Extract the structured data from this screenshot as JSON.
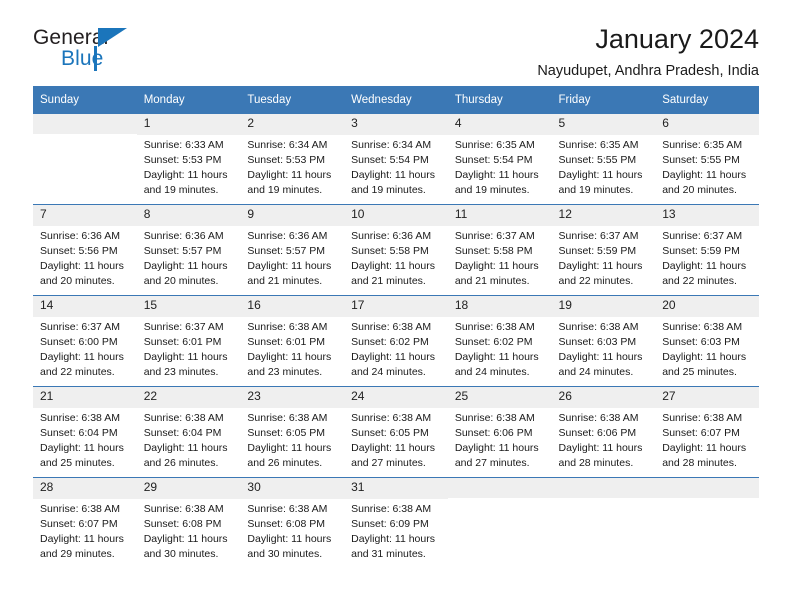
{
  "brand": {
    "name_part1": "General",
    "name_part2": "Blue",
    "accent_color": "#1b75bb"
  },
  "header": {
    "title": "January 2024",
    "subtitle": "Nayudupet, Andhra Pradesh, India"
  },
  "calendar": {
    "header_color": "#3b78b5",
    "daynum_band_color": "#efefef",
    "weekday_labels": [
      "Sunday",
      "Monday",
      "Tuesday",
      "Wednesday",
      "Thursday",
      "Friday",
      "Saturday"
    ],
    "weeks": [
      [
        {
          "date": "",
          "blank": true,
          "sunrise": "",
          "sunset": "",
          "daylight_line1": "",
          "daylight_line2": ""
        },
        {
          "date": "1",
          "sunrise": "Sunrise: 6:33 AM",
          "sunset": "Sunset: 5:53 PM",
          "daylight_line1": "Daylight: 11 hours",
          "daylight_line2": "and 19 minutes."
        },
        {
          "date": "2",
          "sunrise": "Sunrise: 6:34 AM",
          "sunset": "Sunset: 5:53 PM",
          "daylight_line1": "Daylight: 11 hours",
          "daylight_line2": "and 19 minutes."
        },
        {
          "date": "3",
          "sunrise": "Sunrise: 6:34 AM",
          "sunset": "Sunset: 5:54 PM",
          "daylight_line1": "Daylight: 11 hours",
          "daylight_line2": "and 19 minutes."
        },
        {
          "date": "4",
          "sunrise": "Sunrise: 6:35 AM",
          "sunset": "Sunset: 5:54 PM",
          "daylight_line1": "Daylight: 11 hours",
          "daylight_line2": "and 19 minutes."
        },
        {
          "date": "5",
          "sunrise": "Sunrise: 6:35 AM",
          "sunset": "Sunset: 5:55 PM",
          "daylight_line1": "Daylight: 11 hours",
          "daylight_line2": "and 19 minutes."
        },
        {
          "date": "6",
          "sunrise": "Sunrise: 6:35 AM",
          "sunset": "Sunset: 5:55 PM",
          "daylight_line1": "Daylight: 11 hours",
          "daylight_line2": "and 20 minutes."
        }
      ],
      [
        {
          "date": "7",
          "sunrise": "Sunrise: 6:36 AM",
          "sunset": "Sunset: 5:56 PM",
          "daylight_line1": "Daylight: 11 hours",
          "daylight_line2": "and 20 minutes."
        },
        {
          "date": "8",
          "sunrise": "Sunrise: 6:36 AM",
          "sunset": "Sunset: 5:57 PM",
          "daylight_line1": "Daylight: 11 hours",
          "daylight_line2": "and 20 minutes."
        },
        {
          "date": "9",
          "sunrise": "Sunrise: 6:36 AM",
          "sunset": "Sunset: 5:57 PM",
          "daylight_line1": "Daylight: 11 hours",
          "daylight_line2": "and 21 minutes."
        },
        {
          "date": "10",
          "sunrise": "Sunrise: 6:36 AM",
          "sunset": "Sunset: 5:58 PM",
          "daylight_line1": "Daylight: 11 hours",
          "daylight_line2": "and 21 minutes."
        },
        {
          "date": "11",
          "sunrise": "Sunrise: 6:37 AM",
          "sunset": "Sunset: 5:58 PM",
          "daylight_line1": "Daylight: 11 hours",
          "daylight_line2": "and 21 minutes."
        },
        {
          "date": "12",
          "sunrise": "Sunrise: 6:37 AM",
          "sunset": "Sunset: 5:59 PM",
          "daylight_line1": "Daylight: 11 hours",
          "daylight_line2": "and 22 minutes."
        },
        {
          "date": "13",
          "sunrise": "Sunrise: 6:37 AM",
          "sunset": "Sunset: 5:59 PM",
          "daylight_line1": "Daylight: 11 hours",
          "daylight_line2": "and 22 minutes."
        }
      ],
      [
        {
          "date": "14",
          "sunrise": "Sunrise: 6:37 AM",
          "sunset": "Sunset: 6:00 PM",
          "daylight_line1": "Daylight: 11 hours",
          "daylight_line2": "and 22 minutes."
        },
        {
          "date": "15",
          "sunrise": "Sunrise: 6:37 AM",
          "sunset": "Sunset: 6:01 PM",
          "daylight_line1": "Daylight: 11 hours",
          "daylight_line2": "and 23 minutes."
        },
        {
          "date": "16",
          "sunrise": "Sunrise: 6:38 AM",
          "sunset": "Sunset: 6:01 PM",
          "daylight_line1": "Daylight: 11 hours",
          "daylight_line2": "and 23 minutes."
        },
        {
          "date": "17",
          "sunrise": "Sunrise: 6:38 AM",
          "sunset": "Sunset: 6:02 PM",
          "daylight_line1": "Daylight: 11 hours",
          "daylight_line2": "and 24 minutes."
        },
        {
          "date": "18",
          "sunrise": "Sunrise: 6:38 AM",
          "sunset": "Sunset: 6:02 PM",
          "daylight_line1": "Daylight: 11 hours",
          "daylight_line2": "and 24 minutes."
        },
        {
          "date": "19",
          "sunrise": "Sunrise: 6:38 AM",
          "sunset": "Sunset: 6:03 PM",
          "daylight_line1": "Daylight: 11 hours",
          "daylight_line2": "and 24 minutes."
        },
        {
          "date": "20",
          "sunrise": "Sunrise: 6:38 AM",
          "sunset": "Sunset: 6:03 PM",
          "daylight_line1": "Daylight: 11 hours",
          "daylight_line2": "and 25 minutes."
        }
      ],
      [
        {
          "date": "21",
          "sunrise": "Sunrise: 6:38 AM",
          "sunset": "Sunset: 6:04 PM",
          "daylight_line1": "Daylight: 11 hours",
          "daylight_line2": "and 25 minutes."
        },
        {
          "date": "22",
          "sunrise": "Sunrise: 6:38 AM",
          "sunset": "Sunset: 6:04 PM",
          "daylight_line1": "Daylight: 11 hours",
          "daylight_line2": "and 26 minutes."
        },
        {
          "date": "23",
          "sunrise": "Sunrise: 6:38 AM",
          "sunset": "Sunset: 6:05 PM",
          "daylight_line1": "Daylight: 11 hours",
          "daylight_line2": "and 26 minutes."
        },
        {
          "date": "24",
          "sunrise": "Sunrise: 6:38 AM",
          "sunset": "Sunset: 6:05 PM",
          "daylight_line1": "Daylight: 11 hours",
          "daylight_line2": "and 27 minutes."
        },
        {
          "date": "25",
          "sunrise": "Sunrise: 6:38 AM",
          "sunset": "Sunset: 6:06 PM",
          "daylight_line1": "Daylight: 11 hours",
          "daylight_line2": "and 27 minutes."
        },
        {
          "date": "26",
          "sunrise": "Sunrise: 6:38 AM",
          "sunset": "Sunset: 6:06 PM",
          "daylight_line1": "Daylight: 11 hours",
          "daylight_line2": "and 28 minutes."
        },
        {
          "date": "27",
          "sunrise": "Sunrise: 6:38 AM",
          "sunset": "Sunset: 6:07 PM",
          "daylight_line1": "Daylight: 11 hours",
          "daylight_line2": "and 28 minutes."
        }
      ],
      [
        {
          "date": "28",
          "sunrise": "Sunrise: 6:38 AM",
          "sunset": "Sunset: 6:07 PM",
          "daylight_line1": "Daylight: 11 hours",
          "daylight_line2": "and 29 minutes."
        },
        {
          "date": "29",
          "sunrise": "Sunrise: 6:38 AM",
          "sunset": "Sunset: 6:08 PM",
          "daylight_line1": "Daylight: 11 hours",
          "daylight_line2": "and 30 minutes."
        },
        {
          "date": "30",
          "sunrise": "Sunrise: 6:38 AM",
          "sunset": "Sunset: 6:08 PM",
          "daylight_line1": "Daylight: 11 hours",
          "daylight_line2": "and 30 minutes."
        },
        {
          "date": "31",
          "sunrise": "Sunrise: 6:38 AM",
          "sunset": "Sunset: 6:09 PM",
          "daylight_line1": "Daylight: 11 hours",
          "daylight_line2": "and 31 minutes."
        },
        {
          "date": "",
          "blank": true,
          "sunrise": "",
          "sunset": "",
          "daylight_line1": "",
          "daylight_line2": ""
        },
        {
          "date": "",
          "blank": true,
          "sunrise": "",
          "sunset": "",
          "daylight_line1": "",
          "daylight_line2": ""
        },
        {
          "date": "",
          "blank": true,
          "sunrise": "",
          "sunset": "",
          "daylight_line1": "",
          "daylight_line2": ""
        }
      ]
    ]
  }
}
